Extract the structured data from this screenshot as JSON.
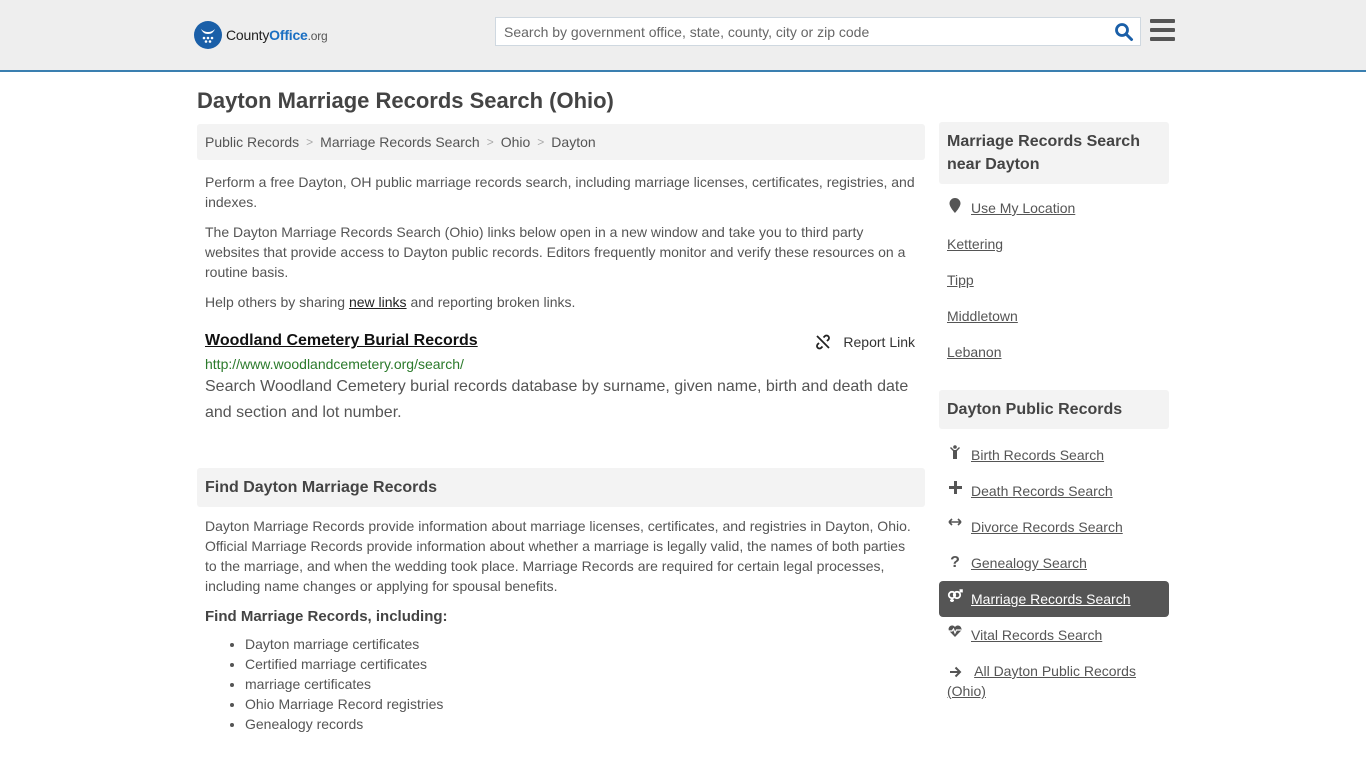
{
  "header": {
    "logo": {
      "brand_part1": "County",
      "brand_part2": "Office",
      "brand_suffix": ".org",
      "icon": "eagle-stars-badge-icon"
    },
    "search": {
      "placeholder": "Search by government office, state, county, city or zip code",
      "value": "",
      "icon": "search-icon"
    },
    "menu_icon": "hamburger-menu-icon",
    "accent_color": "#3a7fb0"
  },
  "page": {
    "title": "Dayton Marriage Records Search (Ohio)"
  },
  "breadcrumb": [
    {
      "label": "Public Records"
    },
    {
      "label": "Marriage Records Search"
    },
    {
      "label": "Ohio"
    },
    {
      "label": "Dayton"
    }
  ],
  "breadcrumb_separator": ">",
  "intro": {
    "p1": "Perform a free Dayton, OH public marriage records search, including marriage licenses, certificates, registries, and indexes.",
    "p2": "The Dayton Marriage Records Search (Ohio) links below open in a new window and take you to third party websites that provide access to Dayton public records. Editors frequently monitor and verify these resources on a routine basis.",
    "p3_before": "Help others by sharing ",
    "p3_link": "new links",
    "p3_after": " and reporting broken links."
  },
  "listing": {
    "title": "Woodland Cemetery Burial Records",
    "url": "http://www.woodlandcemetery.org/search/",
    "description": "Search Woodland Cemetery burial records database by surname, given name, birth and death date and section and lot number.",
    "report_label": "Report Link",
    "report_icon": "broken-link-icon"
  },
  "find_section": {
    "heading": "Find Dayton Marriage Records",
    "body": "Dayton Marriage Records provide information about marriage licenses, certificates, and registries in Dayton, Ohio. Official Marriage Records provide information about whether a marriage is legally valid, the names of both parties to the marriage, and when the wedding took place. Marriage Records are required for certain legal processes, including name changes or applying for spousal benefits.",
    "subheading": "Find Marriage Records, including:",
    "items": [
      "Dayton marriage certificates",
      "Certified marriage certificates",
      "marriage certificates",
      "Ohio Marriage Record registries",
      "Genealogy records"
    ]
  },
  "sidebar": {
    "nearby": {
      "heading": "Marriage Records Search near Dayton",
      "location_label": "Use My Location",
      "location_icon": "map-pin-icon",
      "cities": [
        "Kettering",
        "Tipp",
        "Middletown",
        "Lebanon"
      ]
    },
    "public_records": {
      "heading": "Dayton Public Records",
      "items": [
        {
          "label": "Birth Records Search",
          "icon": "child-icon",
          "active": false
        },
        {
          "label": "Death Records Search",
          "icon": "cross-icon",
          "active": false
        },
        {
          "label": "Divorce Records Search",
          "icon": "arrows-left-right-icon",
          "active": false
        },
        {
          "label": "Genealogy Search",
          "icon": "question-icon",
          "active": false
        },
        {
          "label": "Marriage Records Search",
          "icon": "venus-mars-icon",
          "active": true
        },
        {
          "label": "Vital Records Search",
          "icon": "heartbeat-icon",
          "active": false
        },
        {
          "label": "All Dayton Public Records (Ohio)",
          "icon": "arrow-right-icon",
          "active": false
        }
      ]
    }
  }
}
